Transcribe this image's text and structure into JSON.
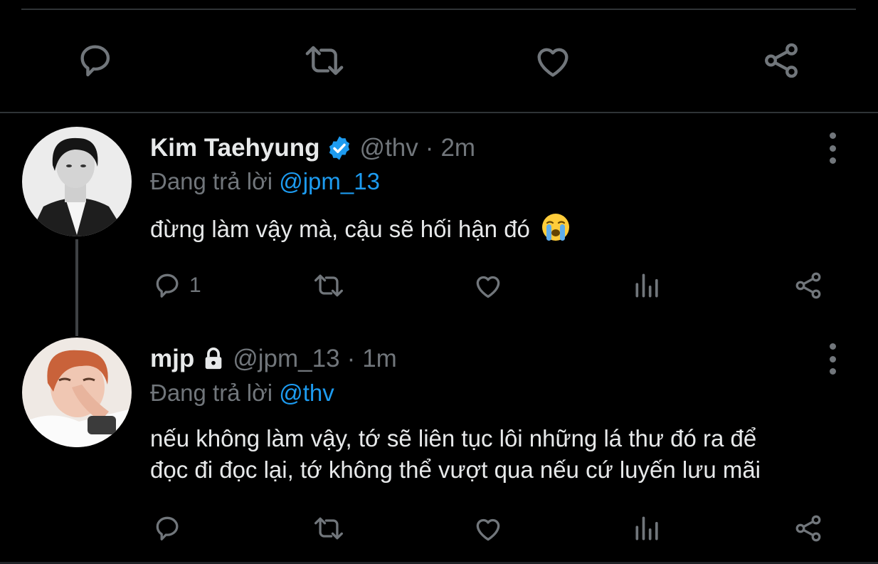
{
  "colors": {
    "background": "#000000",
    "text": "#e7e9ea",
    "muted": "#71767b",
    "accent": "#1d9bf0",
    "divider": "#2f3336"
  },
  "top_actions": [
    "reply-icon",
    "retweet-icon",
    "like-icon",
    "share-icon"
  ],
  "tweets": [
    {
      "name": "Kim Taehyung",
      "verified": true,
      "handle": "@thv",
      "separator": "·",
      "time": "2m",
      "replying_prefix": "Đang trả lời",
      "replying_to": "@jpm_13",
      "text": "đừng làm vậy mà, cậu sẽ hối hận đó",
      "emoji": "loudly-crying-face",
      "reply_count": "1"
    },
    {
      "name": "mjp",
      "locked": true,
      "handle": "@jpm_13",
      "separator": "·",
      "time": "1m",
      "replying_prefix": "Đang trả lời",
      "replying_to": "@thv",
      "text_line1": "nếu không làm vậy, tớ sẽ liên tục lôi những lá thư đó ra để",
      "text_line2": "đọc đi đọc lại, tớ không thể vượt qua nếu cứ luyến lưu mãi",
      "reply_count": ""
    }
  ]
}
